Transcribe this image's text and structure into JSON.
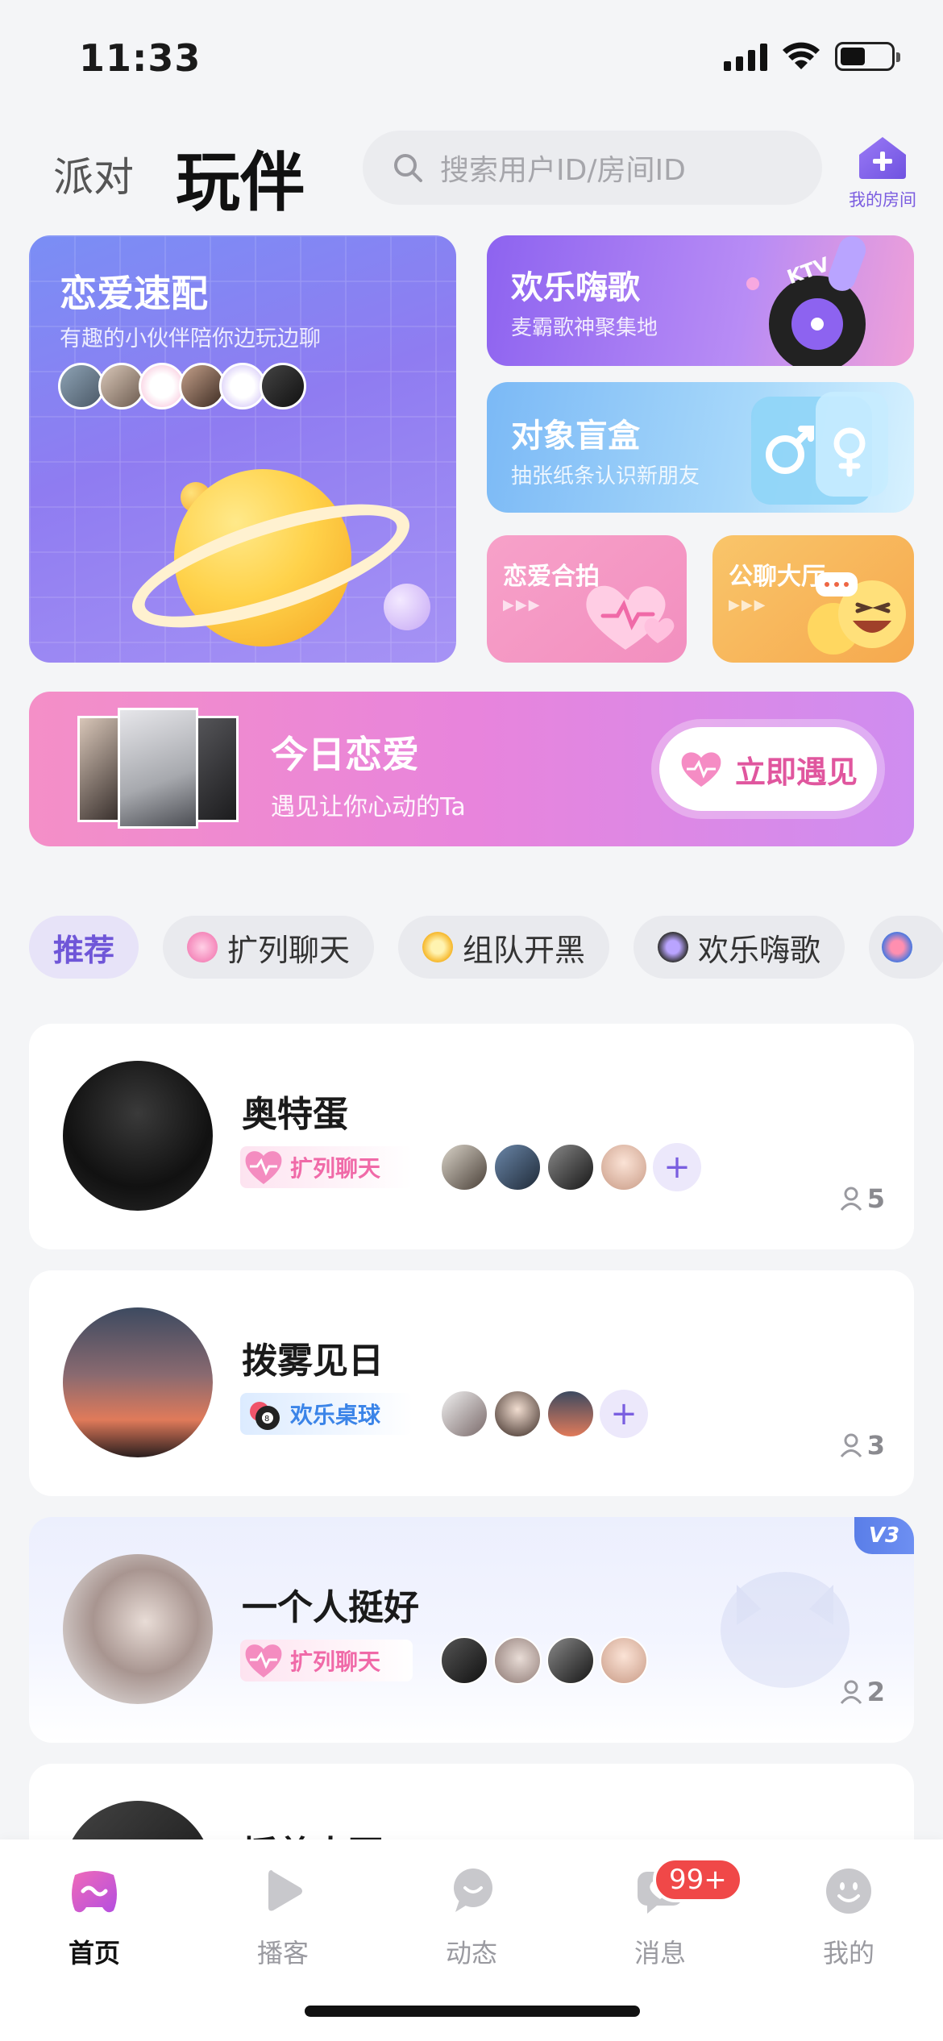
{
  "status_bar": {
    "time": "11:33"
  },
  "header": {
    "tab_party": "派对",
    "tab_playmate": "玩伴",
    "search_placeholder": "搜索用户ID/房间ID",
    "my_room_label": "我的房间"
  },
  "features": {
    "love_match": {
      "title": "恋爱速配",
      "subtitle": "有趣的小伙伴陪你边玩边聊"
    },
    "ktv": {
      "title": "欢乐嗨歌",
      "subtitle": "麦霸歌神聚集地",
      "badge_text": "KTV"
    },
    "blind_box": {
      "title": "对象盲盒",
      "subtitle": "抽张纸条认识新朋友"
    },
    "love_photo": {
      "title": "恋爱合拍"
    },
    "public_hall": {
      "title": "公聊大厅"
    }
  },
  "today_banner": {
    "title": "今日恋爱",
    "subtitle": "遇见让你心动的Ta",
    "button_label": "立即遇见"
  },
  "category_tabs": [
    {
      "label": "推荐",
      "active": true
    },
    {
      "label": "扩列聊天",
      "active": false
    },
    {
      "label": "组队开黑",
      "active": false
    },
    {
      "label": "欢乐嗨歌",
      "active": false
    }
  ],
  "rooms": [
    {
      "name": "奥特蛋",
      "tag": "扩列聊天",
      "tag_style": "pink",
      "count": "5",
      "members_shown": 4,
      "has_plus": true,
      "vip": false
    },
    {
      "name": "拨雾见日",
      "tag": "欢乐桌球",
      "tag_style": "blue",
      "count": "3",
      "members_shown": 3,
      "has_plus": true,
      "vip": false
    },
    {
      "name": "一个人挺好",
      "tag": "扩列聊天",
      "tag_style": "pink",
      "count": "2",
      "members_shown": 4,
      "has_plus": false,
      "vip": true,
      "vip_badge": "V3"
    },
    {
      "name": "摇姜大豆",
      "tag": "",
      "count": "",
      "vip": false
    }
  ],
  "bottom_nav": [
    {
      "label": "首页",
      "active": true,
      "icon": "gamepad-icon"
    },
    {
      "label": "播客",
      "active": false,
      "icon": "play-icon"
    },
    {
      "label": "动态",
      "active": false,
      "icon": "chat-bubble-icon"
    },
    {
      "label": "消息",
      "active": false,
      "icon": "message-heart-icon",
      "badge": "99+"
    },
    {
      "label": "我的",
      "active": false,
      "icon": "smiley-icon"
    }
  ],
  "colors": {
    "accent": "#7b5de0",
    "pink": "#e0569e",
    "badge_red": "#f04848"
  }
}
